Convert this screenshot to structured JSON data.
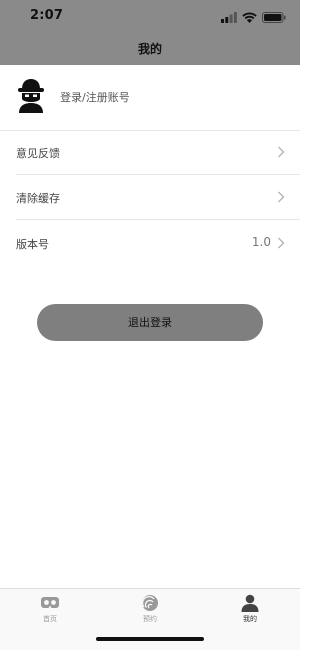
{
  "status_bar": {
    "time": "2:07"
  },
  "nav": {
    "title": "我的"
  },
  "profile": {
    "login_text": "登录/注册账号"
  },
  "menu": [
    {
      "label": "意见反馈",
      "value": ""
    },
    {
      "label": "清除缓存",
      "value": ""
    },
    {
      "label": "版本号",
      "value": "1.0"
    }
  ],
  "logout": {
    "label": "退出登录"
  },
  "tabs": [
    {
      "label": "首页",
      "icon": "vr-headset-icon",
      "active": false
    },
    {
      "label": "预约",
      "icon": "spiral-icon",
      "active": false
    },
    {
      "label": "我的",
      "icon": "person-icon",
      "active": true
    }
  ],
  "colors": {
    "header_bg": "#8a8a8a",
    "button_bg": "#7f7f7f",
    "separator": "#e6e6e6",
    "tab_active": "#333333",
    "tab_inactive": "#999999"
  }
}
